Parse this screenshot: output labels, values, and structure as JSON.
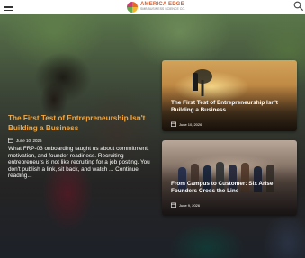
{
  "header": {
    "menu_icon": "hamburger-menu-icon",
    "logo": {
      "name": "AMERICA EDGE",
      "tagline": "SMB BUSINESS SCIENCE CO."
    },
    "search_icon": "search-icon"
  },
  "lead_story": {
    "title": "The First Test of Entrepreneurship Isn't Building a Business",
    "date": "June 10, 2026",
    "excerpt": "What FRP-03 onboarding taught us about commitment, motivation, and founder readiness. Recruiting entrepreneurs is not like recruiting for a job posting. You don't publish a link, sit back, and watch ...",
    "read_more": "Continue reading..."
  },
  "cards": [
    {
      "title": "The First Test of Entrepreneurship Isn't Building a Business",
      "date": "June 10, 2026"
    },
    {
      "title": "From Campus to Customer: Six Arise Founders Cross the Line",
      "date": "June 9, 2026"
    }
  ],
  "colors": {
    "accent": "#f7a73b",
    "brand": "#d95b2a"
  }
}
